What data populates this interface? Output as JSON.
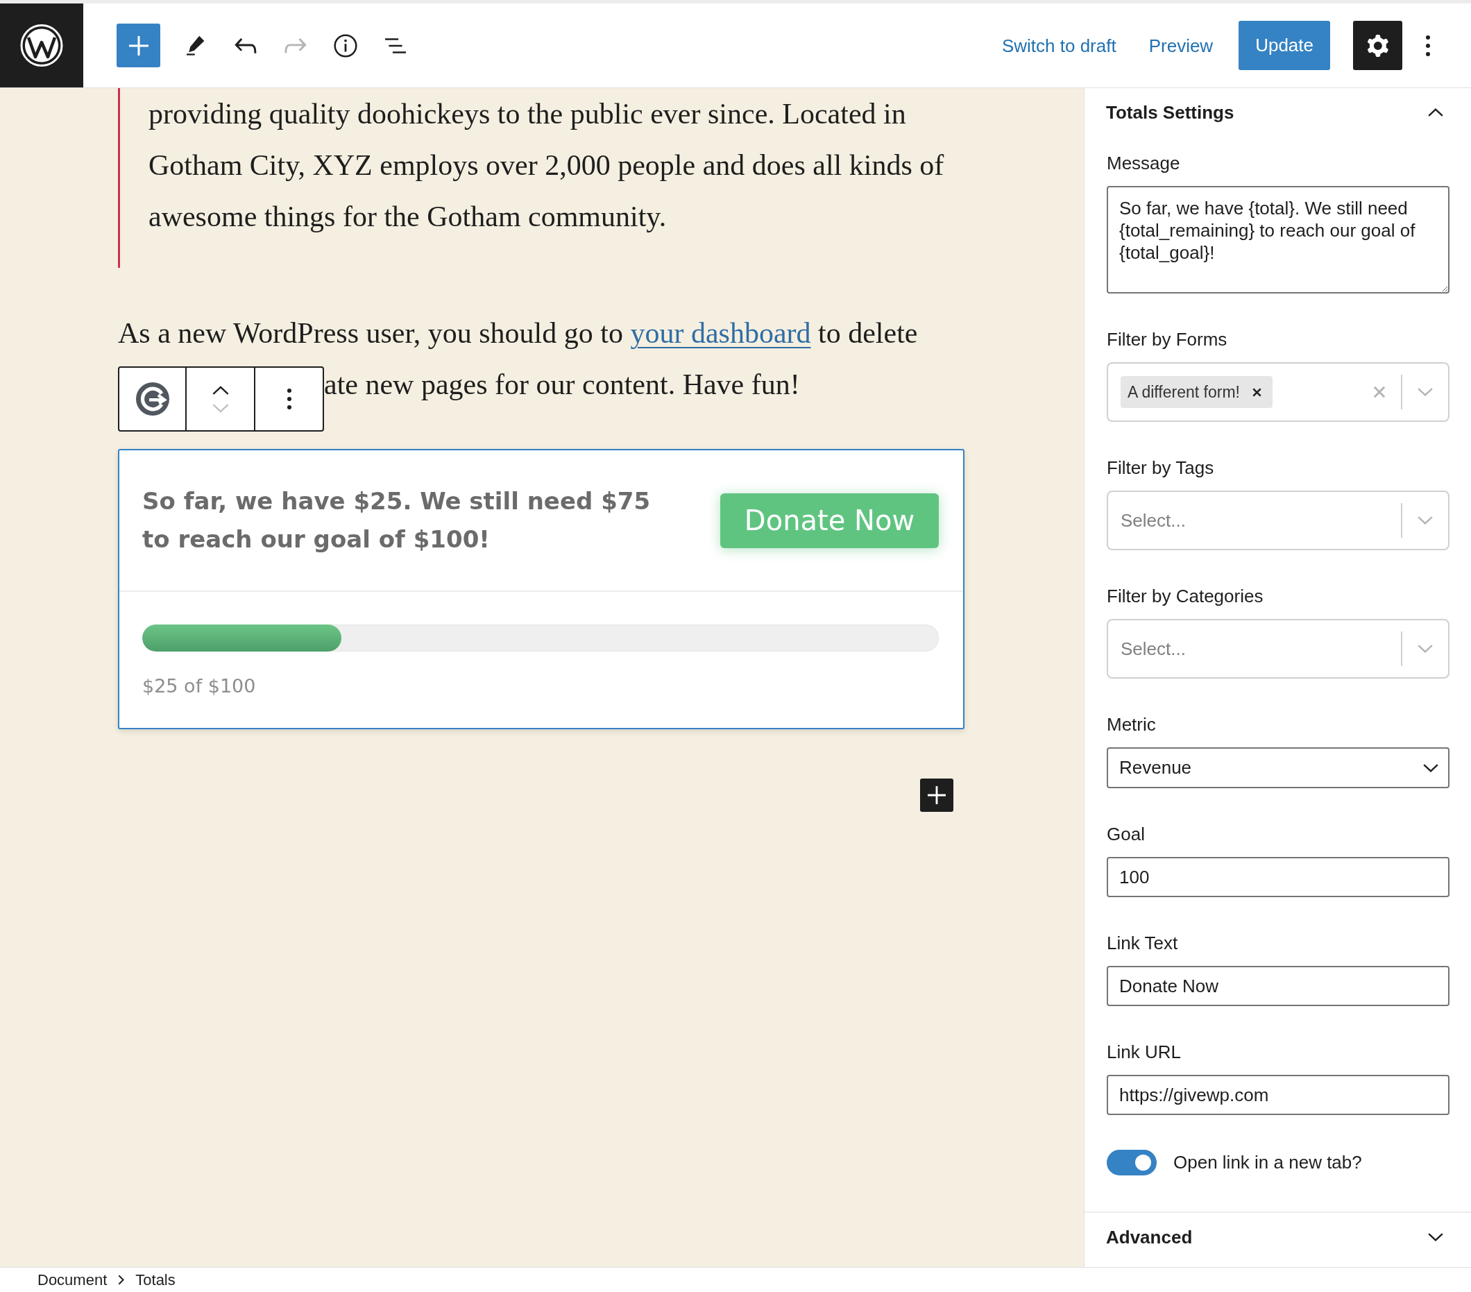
{
  "top_bar": {
    "tools": [
      {
        "kind": "inserter",
        "disabled": false
      },
      {
        "kind": "tools",
        "disabled": false
      },
      {
        "kind": "undo",
        "disabled": false
      },
      {
        "kind": "redo",
        "disabled": true
      },
      {
        "kind": "details",
        "disabled": false
      },
      {
        "kind": "list-view",
        "disabled": false
      }
    ],
    "switch_to_draft": "Switch to draft",
    "preview": "Preview",
    "update": "Update",
    "settings": {
      "pressed": true
    }
  },
  "editor": {
    "quote": "providing quality doohickeys to the public ever since. Located in Gotham City, XYZ employs over 2,000 people and does all kinds of awesome things for the Gotham community.",
    "paragraph": {
      "before_link": "As a new WordPress user, you should go to",
      "link": "your dashboard",
      "after_link": "to delete",
      "continuation": "ate new pages for our content. Have fun!"
    },
    "block_toolbar": {
      "move_up": {
        "disabled": false
      },
      "move_down": {
        "disabled": true
      }
    },
    "totals_block": {
      "message": "So far, we have $25. We still need $75 to reach our goal of $100!",
      "button": "Donate Now",
      "progress": {
        "level": 0.25
      },
      "progress_text": "$25 of $100"
    }
  },
  "sidebar": {
    "panel": {
      "title": "Totals Settings",
      "expanded": true
    },
    "fields": [
      {
        "kind": "textarea",
        "label": "Message",
        "value": "So far, we have {total}. We still need {total_remaining} to reach our goal of {total_goal}!"
      },
      {
        "kind": "multiselect",
        "label": "Filter by Forms",
        "chips": [
          "A different form!"
        ]
      },
      {
        "kind": "multiselect",
        "label": "Filter by Tags",
        "placeholder": "Select..."
      },
      {
        "kind": "multiselect",
        "label": "Filter by Categories",
        "placeholder": "Select..."
      },
      {
        "kind": "select",
        "label": "Metric",
        "value": "Revenue"
      },
      {
        "kind": "text",
        "label": "Goal",
        "value": "100"
      },
      {
        "kind": "text",
        "label": "Link Text",
        "value": "Donate Now"
      },
      {
        "kind": "text",
        "label": "Link URL",
        "value": "https://givewp.com"
      },
      {
        "kind": "toggle",
        "label": "Open link in a new tab?",
        "on": true
      }
    ],
    "advanced": {
      "title": "Advanced",
      "expanded": false
    }
  },
  "breadcrumb": [
    "Document",
    "Totals"
  ]
}
